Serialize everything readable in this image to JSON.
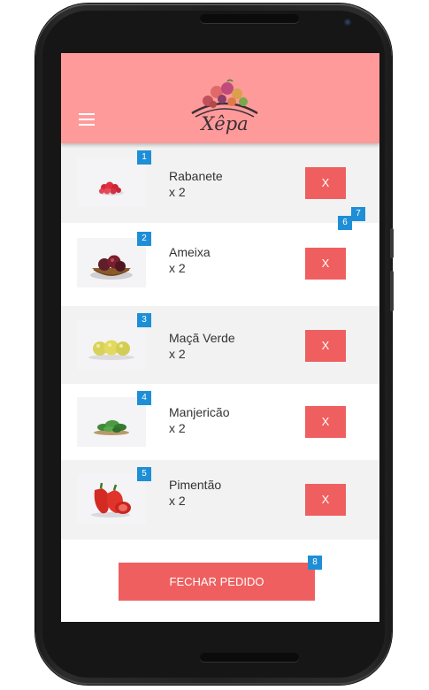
{
  "app": {
    "logo_text": "Xêpa",
    "menu_icon": "hamburger-menu-icon",
    "header_color": "#ff9a9a"
  },
  "cart": {
    "items": [
      {
        "badge": "1",
        "name": "Rabanete",
        "quantity": "x 2",
        "remove_label": "X",
        "image": "radishes"
      },
      {
        "badge": "2",
        "name": "Ameixa",
        "quantity": "x 2",
        "remove_label": "X",
        "image": "plums-in-basket"
      },
      {
        "badge": "3",
        "name": "Maçã Verde",
        "quantity": "x 2",
        "remove_label": "X",
        "image": "green-apples"
      },
      {
        "badge": "4",
        "name": "Manjericão",
        "quantity": "x 2",
        "remove_label": "X",
        "image": "basil"
      },
      {
        "badge": "5",
        "name": "Pimentão",
        "quantity": "x 2",
        "remove_label": "X",
        "image": "red-peppers"
      }
    ],
    "extra_badges": [
      "6",
      "7"
    ],
    "checkout_label": "FECHAR PEDIDO",
    "checkout_badge": "8",
    "accent_color": "#ef5f5f",
    "badge_color": "#1e8fd6"
  }
}
